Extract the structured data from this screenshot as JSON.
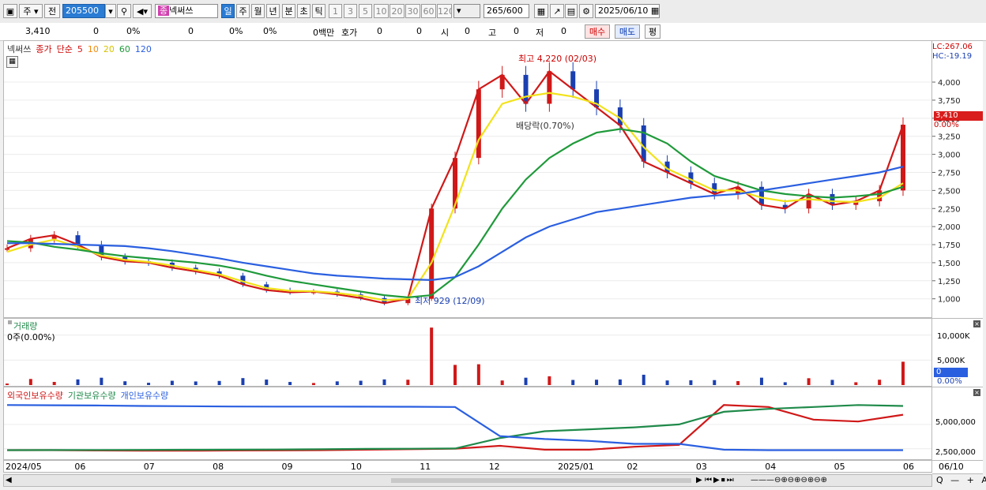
{
  "toolbar": {
    "period_type": "주",
    "prev_label": "전",
    "code": "205500",
    "stock_name": "넥써쓰",
    "stock_badge": "종",
    "tf_day": "일",
    "tf_week": "주",
    "tf_month": "월",
    "tf_year": "년",
    "tf_min": "분",
    "tf_sec": "초",
    "tf_tick": "틱",
    "intervals": [
      "1",
      "3",
      "5",
      "10",
      "20",
      "30",
      "60",
      "120"
    ],
    "count": "265",
    "count_total": "/600",
    "date": "2025/06/10"
  },
  "quote": {
    "price": "3,410",
    "change": "0",
    "change_pct": "0%",
    "volume": "0",
    "volume_pct": "0%",
    "pct2": "0%",
    "amount": "0백만",
    "hoga_label": "호가",
    "hoga1": "0",
    "hoga2": "0",
    "open_label": "시",
    "open": "0",
    "high_label": "고",
    "high": "0",
    "low_label": "저",
    "low": "0",
    "buy_label": "매수",
    "sell_label": "매도",
    "eval_label": "평"
  },
  "price_pane": {
    "legend_name": "넥써쓰",
    "legend_close": "종가",
    "legend_simple": "단순",
    "ma_labels": [
      "5",
      "10",
      "20",
      "60",
      "120"
    ],
    "ma_colors": [
      "#d01818",
      "#f08a10",
      "#f2e21a",
      "#1f9a3a",
      "#2a5fe0"
    ],
    "lc_label": "LC:267.06",
    "hc_label": "HC:-19.19",
    "current_price_tag": "3,410",
    "current_pct_tag": "0.00%",
    "high_annotation": "최고 4,220 (02/03)",
    "low_annotation": "최저 929 (12/09)",
    "dividend_annotation": "배당락(0.70%)"
  },
  "volume_pane": {
    "title": "거래량",
    "sub": "0주(0.00%)",
    "axis_labels": [
      "10,000K",
      "5,000K"
    ],
    "current_tag": "0",
    "current_pct": "0.00%"
  },
  "holdings_pane": {
    "legend": [
      "외국인보유수량",
      "기관보유수량",
      "개인보유수량"
    ],
    "legend_colors": [
      "#d01818",
      "#1f8a4a",
      "#2a5fe0"
    ],
    "axis_labels": [
      "5,000,000",
      "2,500,000"
    ]
  },
  "x_axis": [
    "2024/05",
    "06",
    "07",
    "08",
    "09",
    "10",
    "11",
    "12",
    "2025/01",
    "02",
    "03",
    "04",
    "05",
    "06",
    "06/10"
  ],
  "chart_data": {
    "type": "line",
    "title": "넥써쓰",
    "y_price_ticks": [
      1000,
      1250,
      1500,
      1750,
      2000,
      2250,
      2500,
      2750,
      3000,
      3250,
      3500,
      3750,
      4000
    ],
    "ylim": [
      800,
      4350
    ],
    "x_months": [
      "2024/05",
      "06",
      "07",
      "08",
      "09",
      "10",
      "11",
      "12",
      "2025/01",
      "02",
      "03",
      "04",
      "05",
      "06"
    ],
    "series": [
      {
        "name": "종가",
        "values": [
          1700,
          1830,
          1880,
          1750,
          1580,
          1520,
          1500,
          1430,
          1380,
          1320,
          1200,
          1120,
          1090,
          1100,
          1060,
          1010,
          940,
          1000,
          2250,
          2950,
          3900,
          4100,
          3700,
          4150,
          3900,
          3650,
          3400,
          2900,
          2750,
          2600,
          2450,
          2550,
          2300,
          2250,
          2450,
          2300,
          2350,
          2500,
          3410
        ]
      },
      {
        "name": "MA20",
        "values": [
          1650,
          1750,
          1820,
          1720,
          1600,
          1540,
          1510,
          1460,
          1400,
          1340,
          1240,
          1150,
          1110,
          1105,
          1080,
          1040,
          980,
          1000,
          1500,
          2300,
          3200,
          3700,
          3800,
          3850,
          3800,
          3700,
          3500,
          3100,
          2800,
          2650,
          2500,
          2500,
          2400,
          2350,
          2380,
          2350,
          2340,
          2400,
          2600
        ]
      },
      {
        "name": "MA60",
        "values": [
          1800,
          1780,
          1720,
          1680,
          1630,
          1590,
          1560,
          1530,
          1500,
          1460,
          1400,
          1320,
          1250,
          1200,
          1150,
          1100,
          1050,
          1020,
          1050,
          1300,
          1750,
          2250,
          2650,
          2950,
          3150,
          3300,
          3350,
          3300,
          3150,
          2900,
          2700,
          2600,
          2500,
          2450,
          2420,
          2400,
          2420,
          2450,
          2550
        ]
      },
      {
        "name": "MA120",
        "values": [
          1770,
          1770,
          1760,
          1750,
          1740,
          1730,
          1700,
          1660,
          1610,
          1560,
          1500,
          1450,
          1400,
          1350,
          1320,
          1300,
          1280,
          1270,
          1260,
          1300,
          1450,
          1650,
          1850,
          2000,
          2100,
          2200,
          2250,
          2300,
          2350,
          2400,
          2430,
          2450,
          2500,
          2550,
          2600,
          2650,
          2700,
          2750,
          2830
        ]
      }
    ],
    "volume_ylim": [
      0,
      12000
    ],
    "volume_ticks": [
      5000,
      10000
    ],
    "holdings_ylim": [
      1500000,
      8000000
    ],
    "holdings_ticks": [
      2500000,
      5000000
    ],
    "holdings": {
      "외국인보유수량": [
        2350000,
        2350000,
        2320000,
        2300000,
        2300000,
        2320000,
        2330000,
        2350000,
        2400000,
        2450000,
        2500000,
        2800000,
        2400000,
        2400000,
        2700000,
        2900000,
        7000000,
        6800000,
        5500000,
        5300000,
        6000000
      ],
      "기관보유수량": [
        2350000,
        2360000,
        2370000,
        2380000,
        2390000,
        2400000,
        2420000,
        2450000,
        2480000,
        2500000,
        2520000,
        3600000,
        4300000,
        4500000,
        4700000,
        5000000,
        6300000,
        6600000,
        6800000,
        7000000,
        6900000
      ],
      "개인보유수량": [
        7000000,
        6980000,
        6950000,
        6900000,
        6880000,
        6850000,
        6840000,
        6840000,
        6830000,
        6820000,
        6800000,
        3800000,
        3500000,
        3300000,
        3000000,
        3000000,
        2400000,
        2350000,
        2350000,
        2350000,
        2350000
      ]
    }
  }
}
